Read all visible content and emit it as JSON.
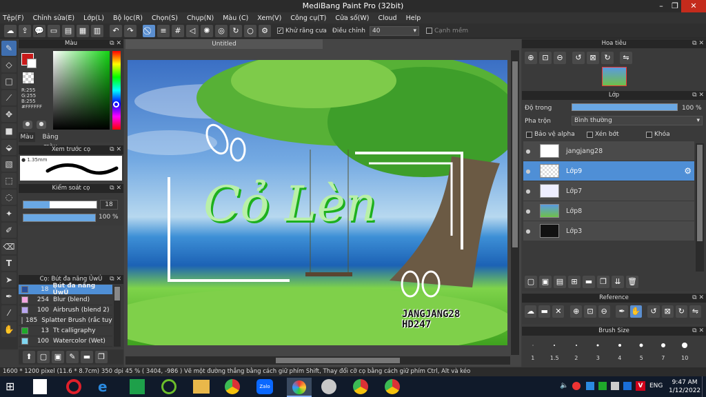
{
  "window": {
    "title": "MediBang Paint Pro (32bit)"
  },
  "menu": [
    "Tệp(F)",
    "Chỉnh sửa(E)",
    "Lớp(L)",
    "Bộ lọc(R)",
    "Chọn(S)",
    "Chụp(N)",
    "Màu (C)",
    "Xem(V)",
    "Công cụ(T)",
    "Cửa số(W)",
    "Cloud",
    "Help"
  ],
  "toolbar": {
    "antialias_label": "Khử răng cưa",
    "adjust_label": "Điều chỉnh",
    "adjust_value": "40",
    "snap_label": "Cạnh mềm"
  },
  "canvas": {
    "tab_title": "Untitled",
    "text_main": "Cỏ Lèn",
    "signature_line1": "JANGJANG28",
    "signature_line2": "HD247"
  },
  "color_panel": {
    "title": "Màu",
    "r": "R:255",
    "g": "G:255",
    "b": "B:255",
    "hex": "#FFFFFF",
    "tab1": "Màu",
    "tab2": "Bảng màu"
  },
  "preview_panel": {
    "title": "Xem trước cọ",
    "size": "1.35mm"
  },
  "brush_control": {
    "title": "Kiểm soát cọ",
    "size": "18",
    "opacity": "100 %"
  },
  "brush_panel": {
    "title": "Cọ: Bút đa năng ỦwÚ",
    "items": [
      {
        "size": "18",
        "name": "Bút đa năng ỦwÚ",
        "color": "#2a4f9a"
      },
      {
        "size": "254",
        "name": "Blur (blend)",
        "color": "#f3a6e0"
      },
      {
        "size": "100",
        "name": "Airbrush (blend 2)",
        "color": "#b9a6f0"
      },
      {
        "size": "185",
        "name": "Splatter Brush (rắc tuyết)",
        "color": "#3a5fe0"
      },
      {
        "size": "13",
        "name": "Tt calligraphy",
        "color": "#1fa82a"
      },
      {
        "size": "100",
        "name": "Watercolor (Wet)",
        "color": "#7fd6f0"
      }
    ]
  },
  "navigator": {
    "title": "Hoa tiêu"
  },
  "layer_panel": {
    "title": "Lớp",
    "opacity_label": "Độ trong",
    "opacity_value": "100 %",
    "blend_label": "Pha trộn",
    "blend_value": "Bình thường",
    "protect_alpha": "Bảo vệ alpha",
    "clipping": "Xén bớt",
    "lock": "Khóa",
    "layers": [
      {
        "name": "jangjang28"
      },
      {
        "name": "Lớp9"
      },
      {
        "name": "Lớp7"
      },
      {
        "name": "Lớp8"
      },
      {
        "name": "Lớp3"
      }
    ]
  },
  "reference": {
    "title": "Reference"
  },
  "brush_size": {
    "title": "Brush Size",
    "sizes": [
      "1",
      "1.5",
      "2",
      "3",
      "4",
      "5",
      "7",
      "10"
    ]
  },
  "status": {
    "text": "1600 * 1200 pixel   (11.6 * 8.7cm)   350 dpi   45 %   ( 3404, -986 )   Vẽ một đường thẳng bằng cách giữ phím Shift, Thay đổi cỡ cọ bằng cách giữ phím Ctrl, Alt và kéo"
  },
  "taskbar": {
    "lang": "ENG",
    "time": "9:47 AM",
    "date": "1/12/2022"
  },
  "colors": {
    "accent": "#4f8fd6",
    "panel": "#3c3c3c"
  }
}
